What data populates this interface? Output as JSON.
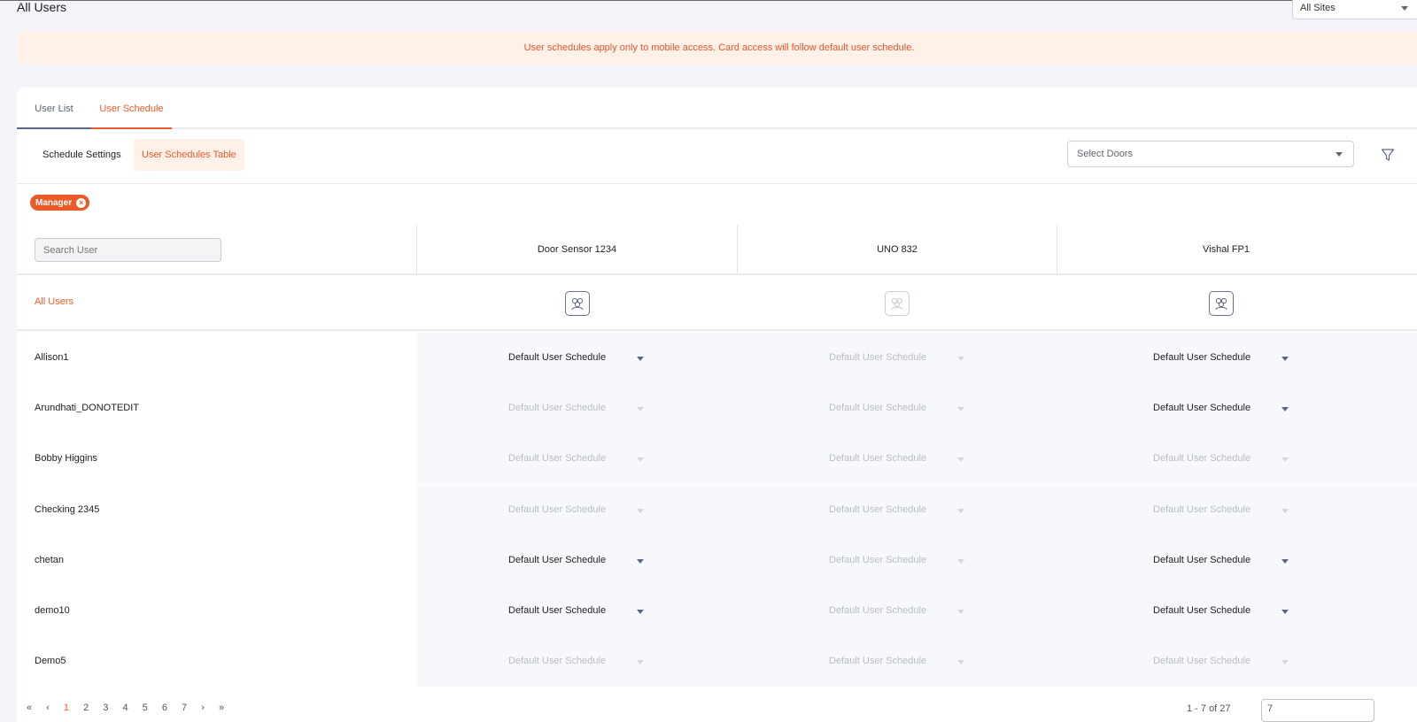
{
  "header": {
    "title": "All Users",
    "site_select": "All Sites"
  },
  "notice": "User schedules apply only to mobile access. Card access will follow default user schedule.",
  "tabs": [
    {
      "label": "User List"
    },
    {
      "label": "User Schedule"
    }
  ],
  "subnav": {
    "settings_label": "Schedule Settings",
    "table_label": "User Schedules Table",
    "door_select_placeholder": "Select Doors"
  },
  "filter_chip": {
    "label": "Manager"
  },
  "table": {
    "search_placeholder": "Search User",
    "doors": [
      "Door Sensor 1234",
      "UNO 832",
      "Vishal FP1"
    ],
    "all_users_label": "All Users",
    "rows": [
      {
        "name": "Allison1",
        "cells": [
          {
            "value": "Default User Schedule",
            "enabled": true
          },
          {
            "value": "Default User Schedule",
            "enabled": false
          },
          {
            "value": "Default User Schedule",
            "enabled": true
          }
        ]
      },
      {
        "name": "Arundhati_DONOTEDIT",
        "cells": [
          {
            "value": "Default User Schedule",
            "enabled": false
          },
          {
            "value": "Default User Schedule",
            "enabled": false
          },
          {
            "value": "Default User Schedule",
            "enabled": true
          }
        ]
      },
      {
        "name": "Bobby Higgins",
        "cells": [
          {
            "value": "Default User Schedule",
            "enabled": false
          },
          {
            "value": "Default User Schedule",
            "enabled": false
          },
          {
            "value": "Default User Schedule",
            "enabled": false
          }
        ]
      },
      {
        "name": "Checking 2345",
        "cells": [
          {
            "value": "Default User Schedule",
            "enabled": false
          },
          {
            "value": "Default User Schedule",
            "enabled": false
          },
          {
            "value": "Default User Schedule",
            "enabled": false
          }
        ]
      },
      {
        "name": "chetan",
        "cells": [
          {
            "value": "Default User Schedule",
            "enabled": true
          },
          {
            "value": "Default User Schedule",
            "enabled": false
          },
          {
            "value": "Default User Schedule",
            "enabled": true
          }
        ]
      },
      {
        "name": "demo10",
        "cells": [
          {
            "value": "Default User Schedule",
            "enabled": true
          },
          {
            "value": "Default User Schedule",
            "enabled": false
          },
          {
            "value": "Default User Schedule",
            "enabled": true
          }
        ]
      },
      {
        "name": "Demo5",
        "cells": [
          {
            "value": "Default User Schedule",
            "enabled": false
          },
          {
            "value": "Default User Schedule",
            "enabled": false
          },
          {
            "value": "Default User Schedule",
            "enabled": false
          }
        ]
      }
    ]
  },
  "pagination": {
    "pages": [
      "1",
      "2",
      "3",
      "4",
      "5",
      "6",
      "7"
    ],
    "current": "1",
    "range_text": "1 - 7 of 27",
    "per_page": "7"
  },
  "colors": {
    "accent": "#ee5a27",
    "notice_bg": "#fff0e8",
    "page_bg": "#f4f5fb",
    "tab_inactive": "#5a6788"
  }
}
